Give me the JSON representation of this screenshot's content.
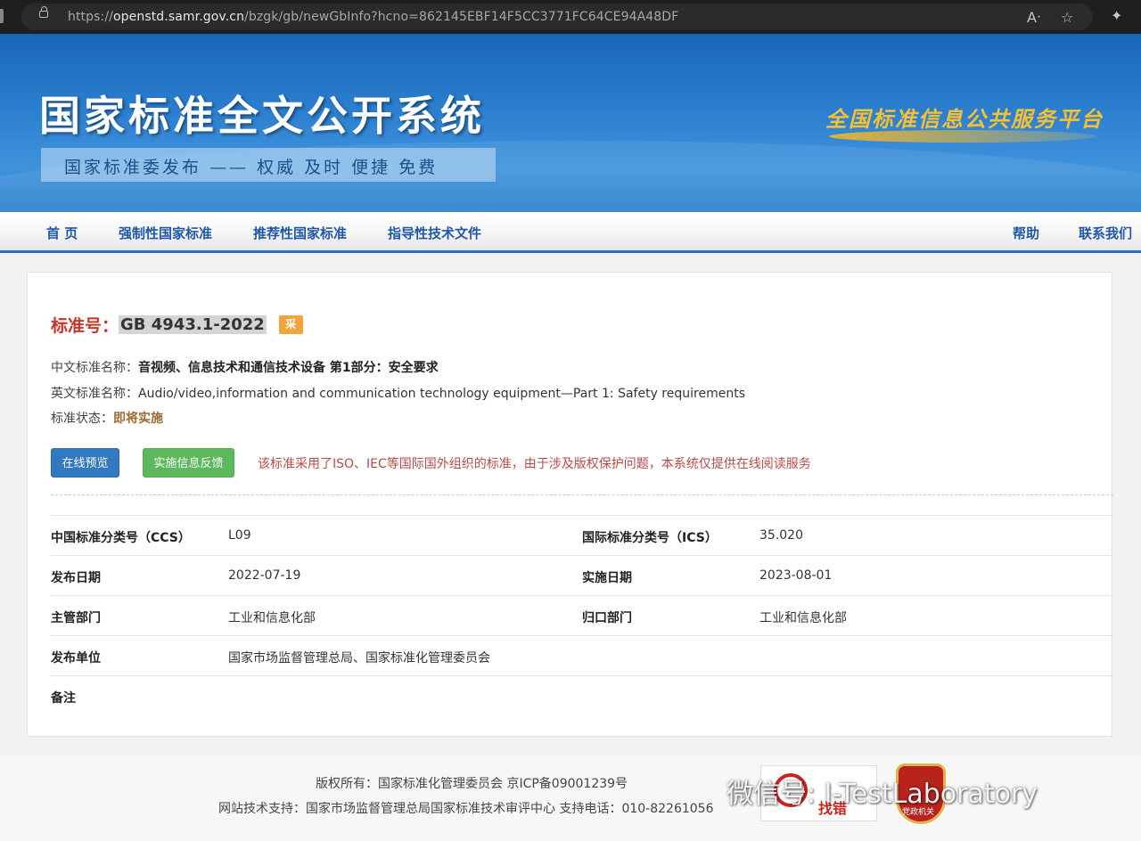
{
  "browser": {
    "url_scheme": "https://",
    "url_host": "openstd.samr.gov.cn",
    "url_path": "/bzgk/gb/newGbInfo?hcno=862145EBF14F5CC3771FC64CE94A48DF"
  },
  "banner": {
    "title": "国家标准全文公开系统",
    "subtitle": "国家标准委发布 —— 权威 及时 便捷 免费",
    "slogan": "全国标准信息公共服务平台"
  },
  "nav": {
    "home": "首 页",
    "mandatory": "强制性国家标准",
    "recommended": "推荐性国家标准",
    "guidance": "指导性技术文件",
    "help": "帮助",
    "contact": "联系我们"
  },
  "standard": {
    "label": "标准号：",
    "code": "GB 4943.1-2022",
    "badge": "采",
    "cn_name_label": "中文标准名称：",
    "cn_name": "音视频、信息技术和通信技术设备 第1部分：安全要求",
    "en_name_label": "英文标准名称：",
    "en_name": "Audio/video,information and communication technology equipment—Part 1: Safety requirements",
    "status_label": "标准状态：",
    "status": "即将实施",
    "preview_btn": "在线预览",
    "feedback_btn": "实施信息反馈",
    "notice": "该标准采用了ISO、IEC等国际国外组织的标准，由于涉及版权保护问题，本系统仅提供在线阅读服务"
  },
  "details": {
    "ccs_label": "中国标准分类号（CCS）",
    "ccs": "L09",
    "ics_label": "国际标准分类号（ICS）",
    "ics": "35.020",
    "publish_label": "发布日期",
    "publish": "2022-07-19",
    "implement_label": "实施日期",
    "implement": "2023-08-01",
    "dept_label": "主管部门",
    "dept": "工业和信息化部",
    "focal_label": "归口部门",
    "focal": "工业和信息化部",
    "issuer_label": "发布单位",
    "issuer": "国家市场监督管理总局、国家标准化管理委员会",
    "remark_label": "备注"
  },
  "footer": {
    "copyright": "版权所有：国家标准化管理委员会 京ICP备09001239号",
    "support": "网站技术支持：国家市场监督管理总局国家标准技术审评中心 支持电话：010-82261056",
    "badge_text": "找错",
    "badge2_text": "党政机关",
    "watermark": "微信号: I-TestLaboratory"
  }
}
